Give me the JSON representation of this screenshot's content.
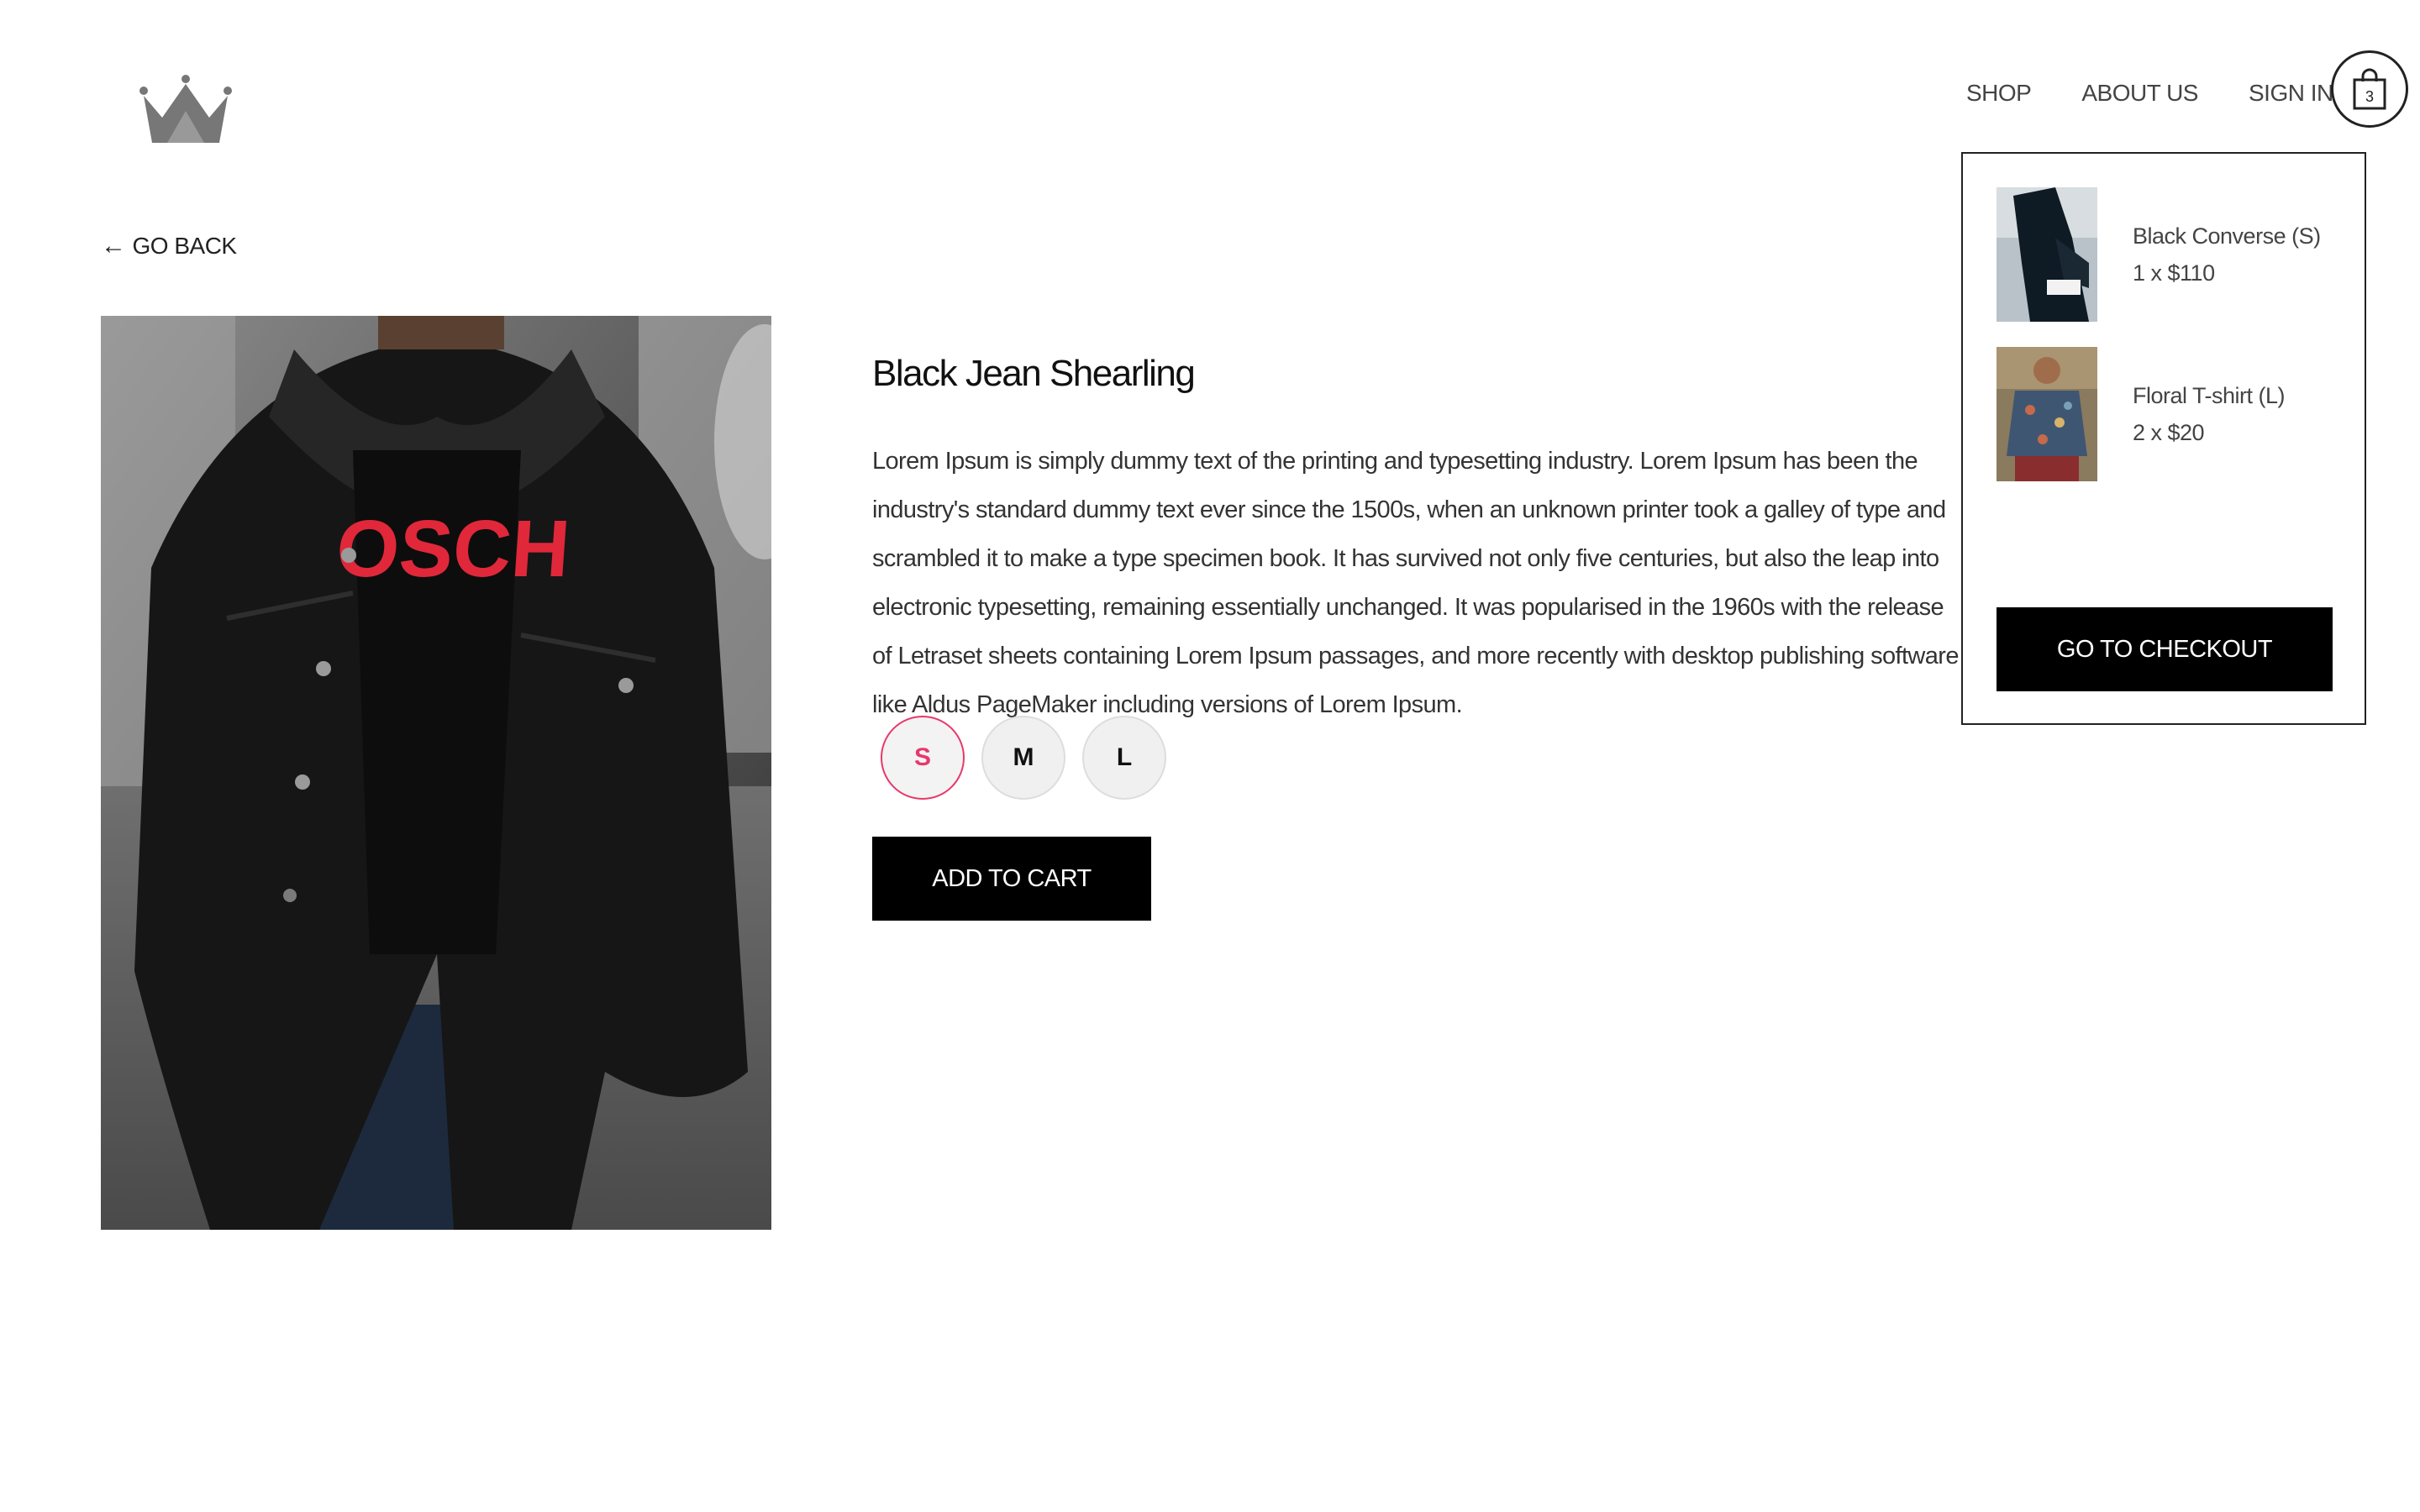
{
  "nav": {
    "shop": "SHOP",
    "about": "ABOUT US",
    "sign_in": "SIGN IN",
    "cart_count": "3"
  },
  "go_back": "GO BACK",
  "product": {
    "title": "Black Jean Shearling",
    "description": "Lorem Ipsum is simply dummy text of the printing and typesetting industry. Lorem Ipsum has been the industry's standard dummy text ever since the 1500s, when an unknown printer took a galley of type and scrambled it to make a type specimen book. It has survived not only five centuries, but also the leap into electronic typesetting, remaining essentially unchanged. It was popularised in the 1960s with the release of Letraset sheets containing Lorem Ipsum passages, and more recently with desktop publishing software like Aldus PageMaker including versions of Lorem Ipsum.",
    "sizes": [
      "S",
      "M",
      "L"
    ],
    "selected_size": "S",
    "add_to_cart": "ADD TO CART"
  },
  "cart": {
    "items": [
      {
        "name": "Black Converse (S)",
        "qty_price": "1 x $110"
      },
      {
        "name": "Floral T-shirt (L)",
        "qty_price": "2 x $20"
      }
    ],
    "checkout": "GO TO CHECKOUT"
  },
  "colors": {
    "accent": "#e8386b",
    "button": "#000000",
    "logo": "#777777"
  },
  "icons": {
    "logo": "crown-icon",
    "cart": "shopping-bag-icon",
    "back": "arrow-left-icon"
  }
}
